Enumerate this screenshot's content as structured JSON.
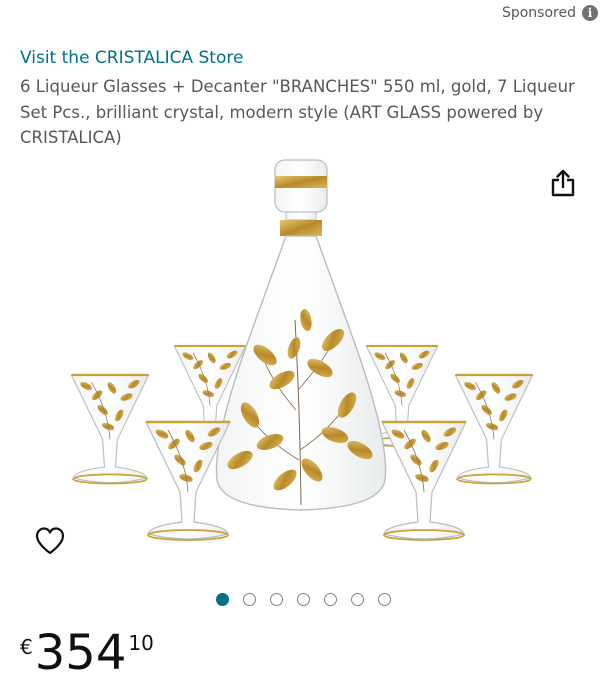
{
  "sponsored": {
    "label": "Sponsored",
    "icon": "info-icon"
  },
  "store": {
    "link_text": "Visit the CRISTALICA Store"
  },
  "product": {
    "title": "6 Liqueur Glasses + Decanter \"BRANCHES\" 550 ml, gold, 7 Liqueur Set Pcs., brilliant crystal, modern style (ART GLASS powered by CRISTALICA)",
    "image_description": "decanter-with-six-liqueur-glasses-gold-leaves"
  },
  "actions": {
    "share_icon": "share-icon",
    "wishlist_icon": "heart-outline-icon"
  },
  "carousel": {
    "total": 7,
    "active_index": 0
  },
  "price": {
    "symbol": "€",
    "whole": "354",
    "fraction": "10"
  },
  "colors": {
    "link": "#007185",
    "text": "#0f1111",
    "muted": "#565959",
    "gold": "#c9a23a"
  }
}
